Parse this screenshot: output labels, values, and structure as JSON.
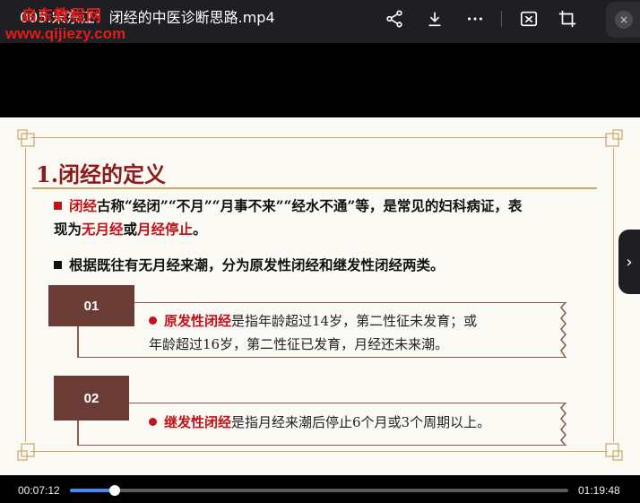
{
  "window": {
    "title": "005.宋东江：闭经的中医诊断思路.mp4",
    "watermark_top": "启东教程网",
    "watermark_url": "www.qijiezy.com"
  },
  "toolbar": {
    "icons": [
      "share-icon",
      "download-icon",
      "more-icon",
      "screen-capture-icon",
      "crop-icon",
      "close-icon"
    ],
    "close_glyph": "×"
  },
  "slide": {
    "heading": "1.闭经的定义",
    "para1": {
      "term": "闭经",
      "text_a": "古称“经闭”“不月”“月事不来”“经水不通”等，是常见的妇科病证，表",
      "text_b": "现为",
      "term2": "无月经",
      "text_c": "或",
      "term3": "月经停止",
      "text_d": "。"
    },
    "para2": "根据既往有无月经来潮，分为原发性闭经和继发性闭经两类。",
    "items": [
      {
        "num": "01",
        "term": "原发性闭经",
        "line1": "是指年龄超过14岁，第二性征未发育；或",
        "line2": "年龄超过16岁，第二性征已发育，月经还未来潮。"
      },
      {
        "num": "02",
        "term": "继发性闭经",
        "line1": "是指月经来潮后停止6个月或3个周期以上。"
      }
    ],
    "accent_red": "#c0121a",
    "accent_brown": "#6b3b36",
    "frame_gold": "#c9a86a"
  },
  "player": {
    "current_time": "00:07:12",
    "total_time": "01:19:48",
    "progress": 0.09,
    "next_glyph": "›"
  }
}
